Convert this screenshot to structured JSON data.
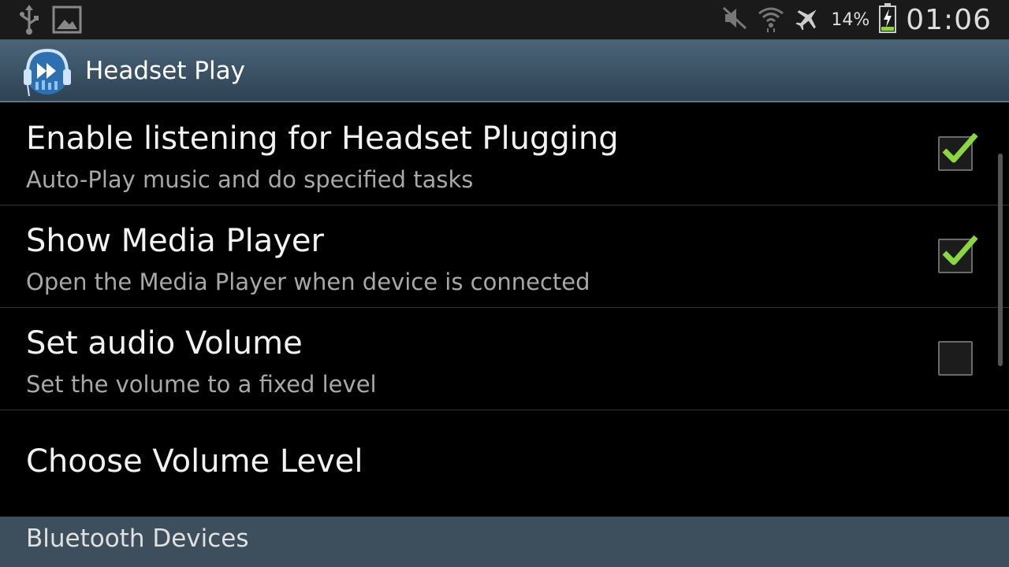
{
  "status_bar": {
    "battery_percent": "14%",
    "time": "01:06",
    "icons": [
      "usb-icon",
      "image-icon",
      "mute-icon",
      "wifi-icon",
      "airplane-icon",
      "battery-charging-icon"
    ]
  },
  "action_bar": {
    "title": "Headset Play",
    "icon": "headphones-app-icon"
  },
  "preferences": [
    {
      "title": "Enable listening for Headset Plugging",
      "summary": "Auto-Play music and do specified tasks",
      "checked": true
    },
    {
      "title": "Show Media Player",
      "summary": "Open the Media Player when device is connected",
      "checked": true
    },
    {
      "title": "Set audio Volume",
      "summary": "Set the volume to a fixed level",
      "checked": false
    },
    {
      "title": "Choose Volume Level"
    }
  ],
  "category": {
    "label": "Bluetooth Devices"
  },
  "colors": {
    "check": "#8bd742",
    "action_bar": "#3e566a",
    "category": "#3d4f5c"
  }
}
